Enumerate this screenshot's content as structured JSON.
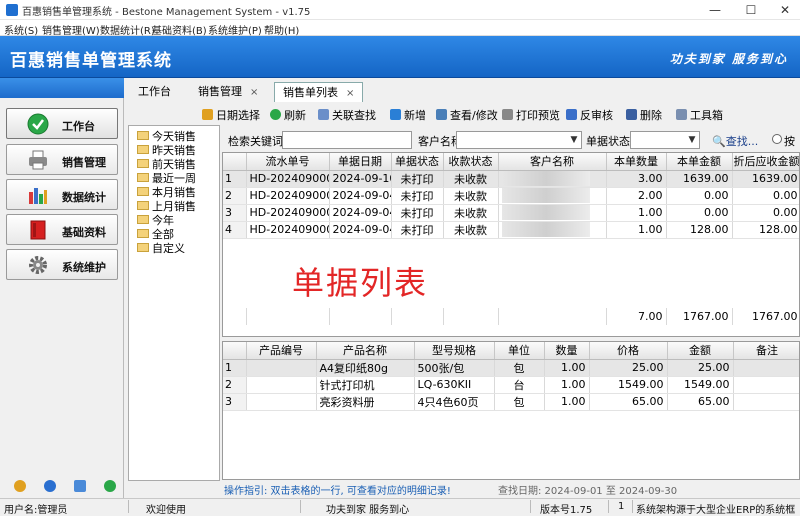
{
  "window": {
    "title": "百惠销售单管理系统 - Bestone Management System - v1.75",
    "minimize": "—",
    "maximize": "☐",
    "close": "✕"
  },
  "menu": [
    "系统(S)",
    "销售管理(W)",
    "数据统计(R)",
    "基础资料(B)",
    "系统维护(P)",
    "帮助(H)"
  ],
  "banner": {
    "title": "百惠销售单管理系统",
    "slogan": "功夫到家 服务到心"
  },
  "nav": [
    {
      "label": "工作台",
      "icon": "checkmark-icon",
      "color": "#2aa748"
    },
    {
      "label": "销售管理",
      "icon": "printer-icon",
      "color": "#777777"
    },
    {
      "label": "数据统计",
      "icon": "bar-chart-icon",
      "color": "#3a6fc9"
    },
    {
      "label": "基础资料",
      "icon": "book-icon",
      "color": "#d62020"
    },
    {
      "label": "系统维护",
      "icon": "gear-icon",
      "color": "#666666"
    }
  ],
  "tabs": [
    {
      "label": "工作台"
    },
    {
      "label": "销售管理",
      "close": "×"
    },
    {
      "label": "销售单列表",
      "close": "×"
    }
  ],
  "toolbar": [
    "日期选择",
    "刷新",
    "关联查找",
    "新增",
    "查看/修改",
    "打印预览",
    "反审核",
    "删除",
    "工具箱"
  ],
  "tree": [
    "今天销售",
    "昨天销售",
    "前天销售",
    "最近一周",
    "本月销售",
    "上月销售",
    "今年",
    "全部",
    "自定义"
  ],
  "filter": {
    "keyword_label": "检索关键词",
    "customer_label": "客户名称",
    "status_label": "单据状态",
    "search_label": "查找...",
    "radio_label": "按"
  },
  "orders": {
    "columns": [
      "",
      "流水单号",
      "单据日期",
      "单据状态",
      "收款状态",
      "客户名称",
      "本单数量",
      "本单金额",
      "折后应收金额"
    ],
    "rows": [
      [
        "1",
        "HD-2024090004",
        "2024-09-10",
        "未打印",
        "未收款",
        "",
        "3.00",
        "1639.00",
        "1639.00"
      ],
      [
        "2",
        "HD-2024090001",
        "2024-09-04",
        "未打印",
        "未收款",
        "",
        "2.00",
        "0.00",
        "0.00"
      ],
      [
        "3",
        "HD-2024090002",
        "2024-09-04",
        "未打印",
        "未收款",
        "",
        "1.00",
        "0.00",
        "0.00"
      ],
      [
        "4",
        "HD-2024090003",
        "2024-09-04",
        "未打印",
        "未收款",
        "",
        "1.00",
        "128.00",
        "128.00"
      ]
    ],
    "totals": {
      "qty": "7.00",
      "amount": "1767.00",
      "net": "1767.00"
    }
  },
  "details": {
    "columns": [
      "",
      "产品编号",
      "产品名称",
      "型号规格",
      "单位",
      "数量",
      "价格",
      "金额",
      "备注"
    ],
    "rows": [
      [
        "1",
        "",
        "A4复印纸80g",
        "500张/包",
        "包",
        "1.00",
        "25.00",
        "25.00",
        ""
      ],
      [
        "2",
        "",
        "针式打印机",
        "LQ-630KII",
        "台",
        "1.00",
        "1549.00",
        "1549.00",
        ""
      ],
      [
        "3",
        "",
        "亮彩资料册",
        "4只4色60页",
        "包",
        "1.00",
        "65.00",
        "65.00",
        ""
      ]
    ]
  },
  "watermark": "单据列表",
  "guide": "操作指引: 双击表格的一行, 可查看对应的明细记录!",
  "query_date": "查找日期: 2024-09-01 至 2024-09-30",
  "status": {
    "user": "用户名:管理员",
    "welcome": "欢迎使用",
    "slogan": "功夫到家 服务到心",
    "version": "版本号1.75",
    "page": "1",
    "info": "系统架构源于大型企业ERP的系统框"
  }
}
